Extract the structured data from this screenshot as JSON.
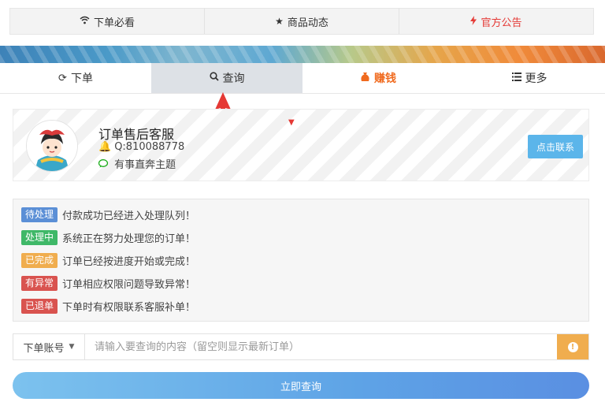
{
  "top_tabs": [
    {
      "label": "下单必看",
      "icon": "wifi-icon",
      "color": "#333333"
    },
    {
      "label": "商品动态",
      "icon": "star-icon",
      "color": "#333333"
    },
    {
      "label": "官方公告",
      "icon": "bolt-icon",
      "color": "#e53935"
    }
  ],
  "nav_tabs": [
    {
      "label": "下单",
      "icon": "refresh-icon",
      "active": false
    },
    {
      "label": "查询",
      "icon": "search-icon",
      "active": true
    },
    {
      "label": "赚钱",
      "icon": "bag-icon",
      "active": false,
      "color": "#f06a1e"
    },
    {
      "label": "更多",
      "icon": "list-icon",
      "active": false
    }
  ],
  "service": {
    "title": "订单售后客服",
    "qq": "Q:810088778",
    "desc": "有事直奔主题",
    "contact_label": "点击联系"
  },
  "legend": [
    {
      "badge": "待处理",
      "color": "#5b8fd6",
      "text": "付款成功已经进入处理队列！"
    },
    {
      "badge": "处理中",
      "color": "#3fb868",
      "text": "系统正在努力处理您的订单！"
    },
    {
      "badge": "已完成",
      "color": "#f0ad4e",
      "text": "订单已经按进度开始或完成！"
    },
    {
      "badge": "有异常",
      "color": "#d9534f",
      "text": "订单相应权限问题导致异常！"
    },
    {
      "badge": "已退单",
      "color": "#d9534f",
      "text": "下单时有权限联系客服补单！"
    }
  ],
  "search": {
    "select_value": "下单账号",
    "placeholder": "请输入要查询的内容（留空则显示最新订单）",
    "value": ""
  },
  "submit_label": "立即查询",
  "colors": {
    "accent": "#5ea3e6",
    "warning": "#f0ad4e",
    "orange": "#f06a1e",
    "red": "#e53935"
  }
}
